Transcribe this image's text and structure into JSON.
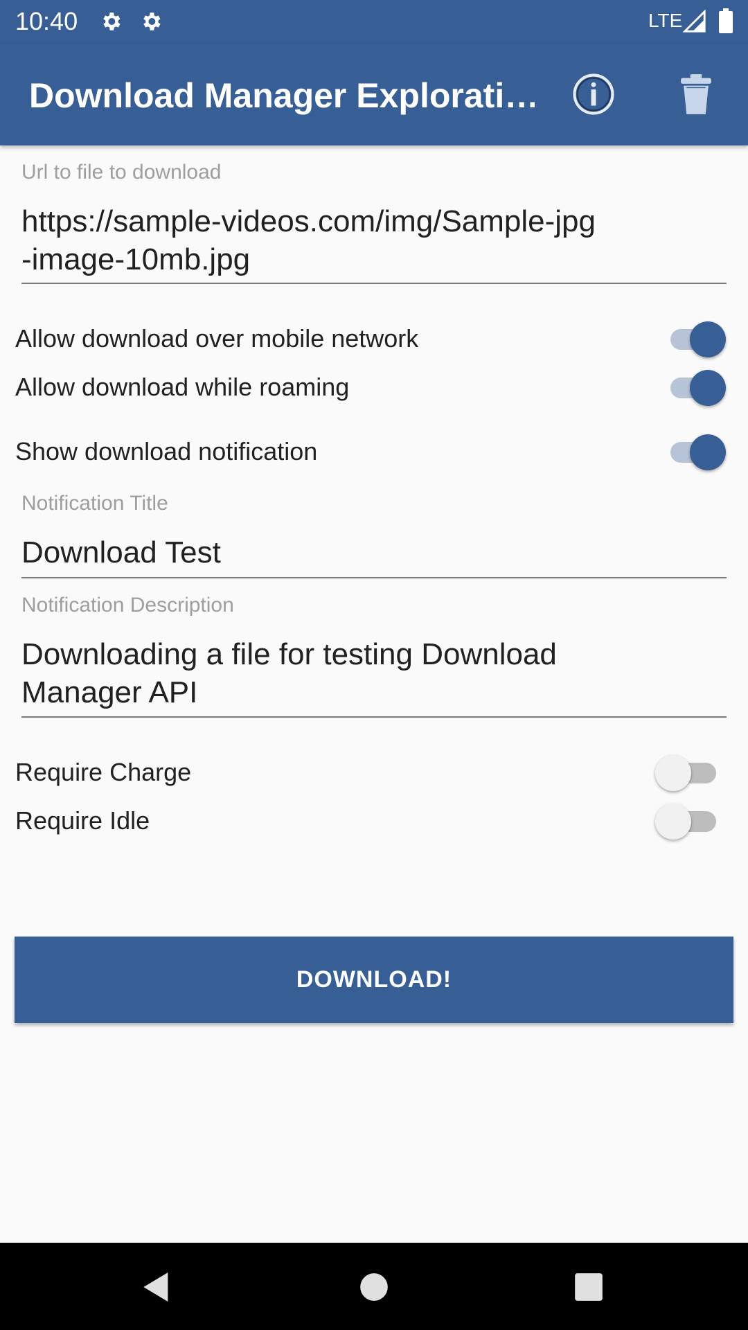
{
  "status_bar": {
    "time": "10:40",
    "network": "LTE",
    "icons": [
      "gear-icon",
      "gear-icon",
      "signal-icon",
      "battery-icon"
    ]
  },
  "app_bar": {
    "title": "Download Manager Explorati…",
    "actions": [
      "info-icon",
      "trash-icon"
    ]
  },
  "form": {
    "url": {
      "label": "Url to file to download",
      "value_line1": "https://sample-videos.com/img/Sample-jpg",
      "value_line2": "-image-10mb.jpg"
    },
    "switches": {
      "mobile_network": {
        "label": "Allow download over mobile network",
        "checked": true
      },
      "roaming": {
        "label": "Allow download while roaming",
        "checked": true
      },
      "notification": {
        "label": "Show download notification",
        "checked": true
      },
      "require_charge": {
        "label": "Require Charge",
        "checked": false
      },
      "require_idle": {
        "label": "Require Idle",
        "checked": false
      }
    },
    "notification_title": {
      "label": "Notification Title",
      "value": "Download Test"
    },
    "notification_description": {
      "label": "Notification Description",
      "value_line1": "Downloading a file for testing Download",
      "value_line2": "Manager API"
    },
    "download_button": "DOWNLOAD!"
  },
  "nav_bar": {
    "buttons": [
      "back-icon",
      "home-icon",
      "recents-icon"
    ]
  },
  "colors": {
    "primary": "#385e96",
    "background": "#fafafa",
    "switch_track_on": "#b7c4d8"
  }
}
